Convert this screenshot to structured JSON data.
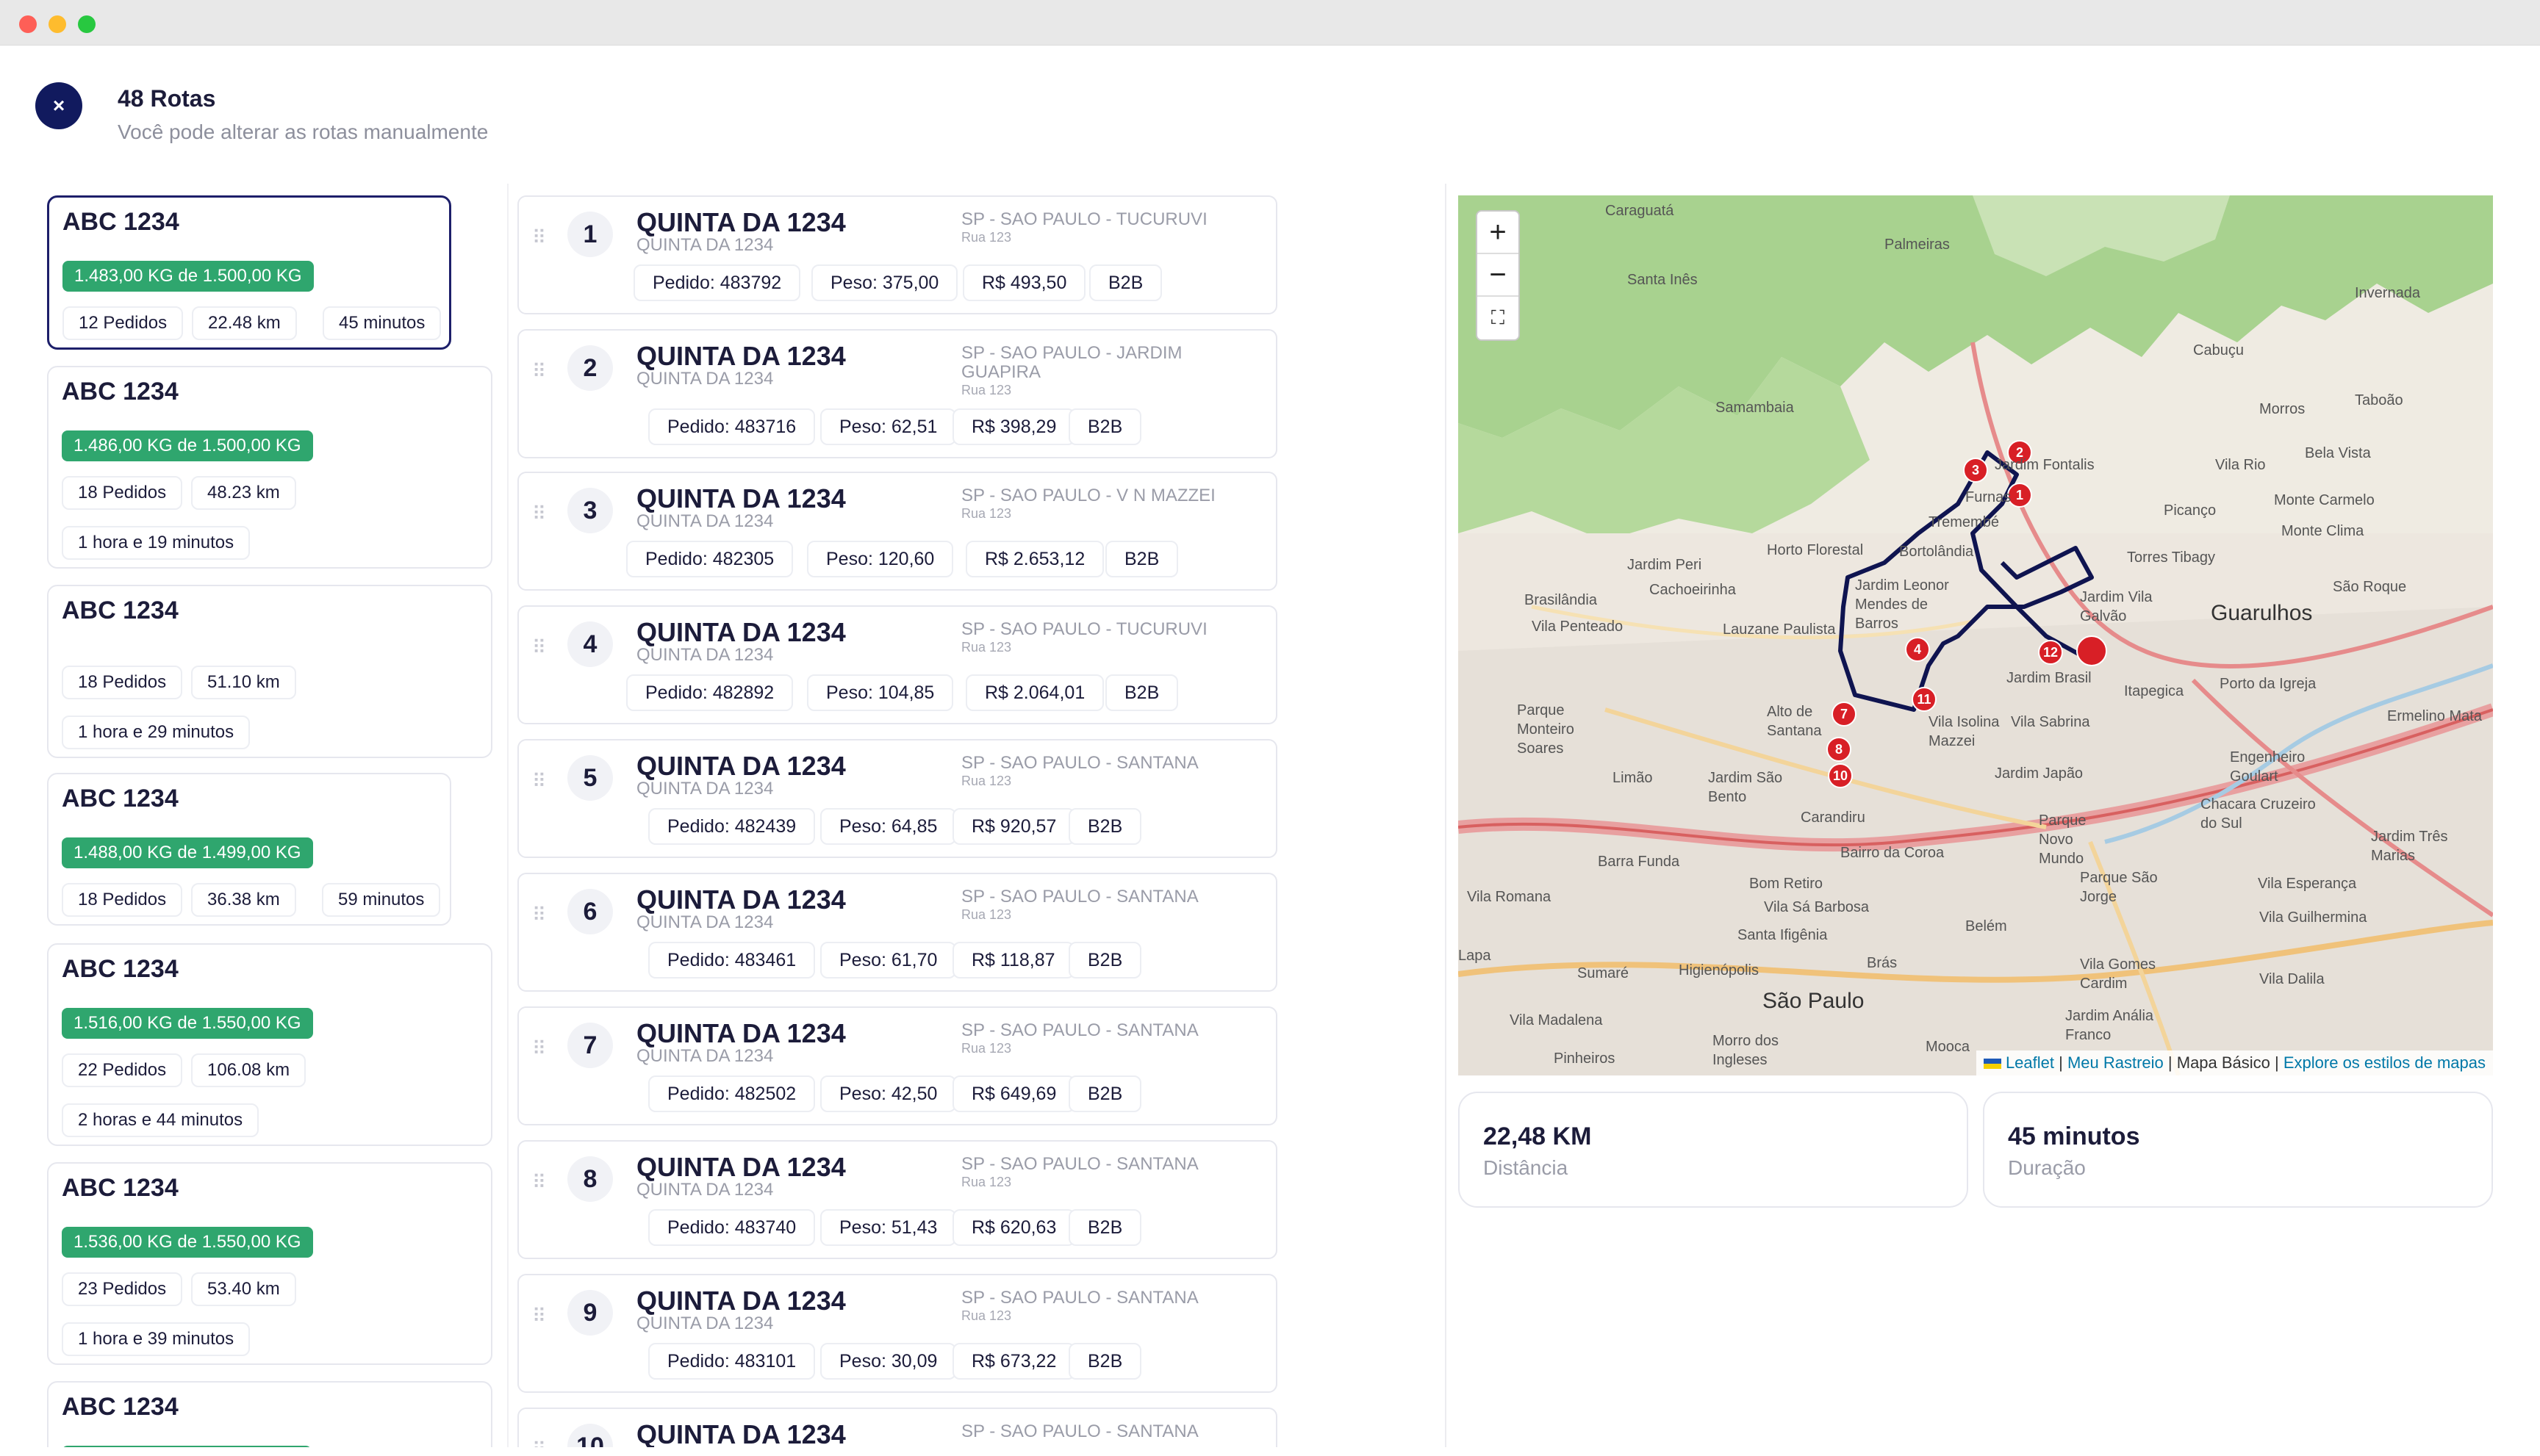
{
  "header": {
    "title": "48 Rotas",
    "subtitle": "Você pode alterar as rotas manualmente",
    "close_label": "×"
  },
  "routes": [
    {
      "name": "ABC 1234",
      "weight": "1.483,00 KG de 1.500,00 KG",
      "orders": "12 Pedidos",
      "distance": "22.48 km",
      "duration": "45 minutos",
      "selected": true
    },
    {
      "name": "ABC 1234",
      "weight": "1.486,00 KG de 1.500,00 KG",
      "orders": "18 Pedidos",
      "distance": "48.23 km",
      "duration": "1 hora e 19 minutos"
    },
    {
      "name": "ABC 1234",
      "weight": "",
      "orders": "18 Pedidos",
      "distance": "51.10 km",
      "duration": "1 hora e 29 minutos"
    },
    {
      "name": "ABC 1234",
      "weight": "1.488,00 KG de 1.499,00 KG",
      "orders": "18 Pedidos",
      "distance": "36.38 km",
      "duration": "59 minutos"
    },
    {
      "name": "ABC 1234",
      "weight": "1.516,00 KG de 1.550,00 KG",
      "orders": "22 Pedidos",
      "distance": "106.08 km",
      "duration": "2 horas e 44 minutos"
    },
    {
      "name": "ABC 1234",
      "weight": "1.536,00 KG de 1.550,00 KG",
      "orders": "23 Pedidos",
      "distance": "53.40 km",
      "duration": "1 hora e 39 minutos"
    },
    {
      "name": "ABC 1234",
      "weight": "",
      "orders": "",
      "distance": "",
      "duration": ""
    }
  ],
  "stops": [
    {
      "num": "1",
      "name": "QUINTA DA 1234",
      "subname": "QUINTA DA 1234",
      "region": "SP - SAO PAULO - TUCURUVI",
      "street": "Rua 123",
      "order": "Pedido: 483792",
      "weight": "Peso: 375,00",
      "value": "R$ 493,50",
      "type": "B2B"
    },
    {
      "num": "2",
      "name": "QUINTA DA 1234",
      "subname": "QUINTA DA 1234",
      "region": "SP - SAO PAULO - JARDIM GUAPIRA",
      "street": "Rua 123",
      "order": "Pedido: 483716",
      "weight": "Peso: 62,51",
      "value": "R$ 398,29",
      "type": "B2B"
    },
    {
      "num": "3",
      "name": "QUINTA DA 1234",
      "subname": "QUINTA DA 1234",
      "region": "SP - SAO PAULO - V N MAZZEI",
      "street": "Rua 123",
      "order": "Pedido: 482305",
      "weight": "Peso: 120,60",
      "value": "R$ 2.653,12",
      "type": "B2B"
    },
    {
      "num": "4",
      "name": "QUINTA DA 1234",
      "subname": "QUINTA DA 1234",
      "region": "SP - SAO PAULO - TUCURUVI",
      "street": "Rua 123",
      "order": "Pedido: 482892",
      "weight": "Peso: 104,85",
      "value": "R$ 2.064,01",
      "type": "B2B"
    },
    {
      "num": "5",
      "name": "QUINTA DA 1234",
      "subname": "QUINTA DA 1234",
      "region": "SP - SAO PAULO - SANTANA",
      "street": "Rua 123",
      "order": "Pedido: 482439",
      "weight": "Peso: 64,85",
      "value": "R$ 920,57",
      "type": "B2B"
    },
    {
      "num": "6",
      "name": "QUINTA DA 1234",
      "subname": "QUINTA DA 1234",
      "region": "SP - SAO PAULO - SANTANA",
      "street": "Rua 123",
      "order": "Pedido: 483461",
      "weight": "Peso: 61,70",
      "value": "R$ 118,87",
      "type": "B2B"
    },
    {
      "num": "7",
      "name": "QUINTA DA 1234",
      "subname": "QUINTA DA 1234",
      "region": "SP - SAO PAULO - SANTANA",
      "street": "Rua 123",
      "order": "Pedido: 482502",
      "weight": "Peso: 42,50",
      "value": "R$ 649,69",
      "type": "B2B"
    },
    {
      "num": "8",
      "name": "QUINTA DA 1234",
      "subname": "QUINTA DA 1234",
      "region": "SP - SAO PAULO - SANTANA",
      "street": "Rua 123",
      "order": "Pedido: 483740",
      "weight": "Peso: 51,43",
      "value": "R$ 620,63",
      "type": "B2B"
    },
    {
      "num": "9",
      "name": "QUINTA DA 1234",
      "subname": "QUINTA DA 1234",
      "region": "SP - SAO PAULO - SANTANA",
      "street": "Rua 123",
      "order": "Pedido: 483101",
      "weight": "Peso: 30,09",
      "value": "R$ 673,22",
      "type": "B2B"
    },
    {
      "num": "10",
      "name": "QUINTA DA 1234",
      "subname": "",
      "region": "SP - SAO PAULO - SANTANA",
      "street": "",
      "order": "",
      "weight": "",
      "value": "",
      "type": ""
    }
  ],
  "map": {
    "zoom_in": "+",
    "zoom_out": "−",
    "fullscreen": "⛶",
    "attribution": {
      "leaflet": "Leaflet",
      "sep1": " | ",
      "meu_rastreio": "Meu Rastreio",
      "sep2": " | Mapa Básico | ",
      "explore": "Explore os estilos de mapas"
    },
    "labels": {
      "caraguata": "Caraguatá",
      "palmeiras": "Palmeiras",
      "santa_ines": "Santa Inês",
      "invernada": "Invernada",
      "cabucu": "Cabuçu",
      "samambaia": "Samambaia",
      "taboao": "Taboão",
      "morros": "Morros",
      "jardim_fontalis": "Jardim Fontalis",
      "vila_rio": "Vila Rio",
      "bela_vista": "Bela Vista",
      "furnas": "Furnas",
      "picanco": "Picanço",
      "monte_carmelo": "Monte Carmelo",
      "tremembe": "Tremembé",
      "monte_clima": "Monte Clima",
      "horto_florestal": "Horto Florestal",
      "bortolandia": "Bortolândia",
      "torres_tibagy": "Torres Tibagy",
      "jardim_peri": "Jardim Peri",
      "cachoeirinha": "Cachoeirinha",
      "brasilandia": "Brasilândia",
      "jardim_leonor": "Jardim Leonor Mendes de Barros",
      "jardim_vila_galvao": "Jardim Vila Galvão",
      "guarulhos": "Guarulhos",
      "sao_roque": "São Roque",
      "vila_penteado": "Vila Penteado",
      "lauzane": "Lauzane Paulista",
      "jardim_brasil": "Jardim Brasil",
      "itapegica": "Itapegica",
      "porto_igreja": "Porto da Igreja",
      "parque_monteiro": "Parque Monteiro Soares",
      "alto_santana": "Alto de Santana",
      "vila_isolina": "Vila Isolina Mazzei",
      "vila_sabrina": "Vila Sabrina",
      "ermelino": "Ermelino Mata",
      "limao": "Limão",
      "jardim_sao_bento": "Jardim São Bento",
      "jardim_japao": "Jardim Japão",
      "engenheiro_goulart": "Engenheiro Goulart",
      "carandiru": "Carandiru",
      "parque_novo_mundo": "Parque Novo Mundo",
      "chacara_cruzeiro": "Chacara Cruzeiro do Sul",
      "barra_funda": "Barra Funda",
      "bairro_coroa": "Bairro da Coroa",
      "jardim_tres_marias": "Jardim Três Marias",
      "bom_retiro": "Bom Retiro",
      "parque_sao_jorge": "Parque São Jorge",
      "vila_esperanca": "Vila Esperança",
      "vila_romana": "Vila Romana",
      "vila_sa_barbosa": "Vila Sá Barbosa",
      "belem": "Belém",
      "vila_guilhermina": "Vila Guilhermina",
      "santa_ifigenia": "Santa Ifigênia",
      "bras": "Brás",
      "vila_gomes_cardim": "Vila Gomes Cardim",
      "vila_dalila": "Vila Dalila",
      "sao_paulo": "São Paulo",
      "jardim_anália_franco": "Jardim Anália Franco",
      "vila_madalena": "Vila Madalena",
      "pinheiros": "Pinheiros",
      "mooca": "Mooca",
      "morro_ingleses": "Morro dos Ingleses",
      "sumare": "Sumaré",
      "higienopolis": "Higienópolis",
      "lapa": "Lapa"
    },
    "markers": [
      "1",
      "2",
      "3",
      "4",
      "7",
      "8",
      "10",
      "11",
      "12"
    ],
    "route_color": "#0f1450",
    "marker_color": "#d81f26"
  },
  "stats": {
    "distance_value": "22,48 KM",
    "distance_label": "Distância",
    "duration_value": "45 minutos",
    "duration_label": "Duração"
  },
  "colors": {
    "brand_navy": "#111a5e",
    "weight_green": "#2fa66e",
    "selected_border": "#1d1f6a"
  }
}
